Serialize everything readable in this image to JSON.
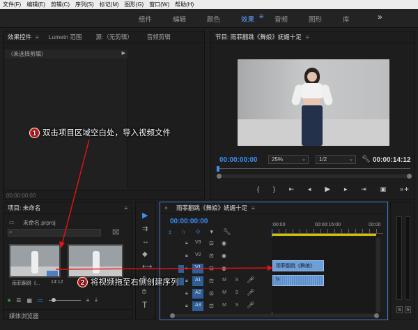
{
  "menu": [
    "文件(F)",
    "编辑(E)",
    "剪辑(C)",
    "序列(S)",
    "标记(M)",
    "图形(G)",
    "窗口(W)",
    "帮助(H)"
  ],
  "workspaces": {
    "items": [
      "组件",
      "编辑",
      "颜色",
      "效果",
      "音频",
      "图形",
      "库"
    ],
    "active": "效果",
    "more": "»"
  },
  "effect_panel": {
    "tabs": [
      "效果控件",
      "Lumetri 范围",
      "源:（无剪辑）",
      "音频剪辑"
    ],
    "no_clip": "（未选择剪辑）",
    "timecode": "00:00:00:00"
  },
  "program": {
    "title": "节目: 雨菲翻跳《舞娘》妩媚十足",
    "timecode": "00:00:00:00",
    "fit": "25%",
    "quality": "1/2",
    "duration": "00:00:14:12"
  },
  "project": {
    "title": "项目: 未命名",
    "file": "未命名.prproj",
    "clip_name": "雨菲翻跳《...",
    "clip_duration": "14:12",
    "media_browser": "媒体浏览器"
  },
  "timeline": {
    "title": "雨菲翻跳《舞娘》妩媚十足",
    "timecode": "00:00:00:00",
    "ruler": [
      ":00:00",
      "00:00:15:00",
      "00:00"
    ],
    "video_tracks": [
      "V3",
      "V2",
      "V1"
    ],
    "audio_tracks": [
      "A1",
      "A2",
      "A3"
    ],
    "clip_label": "雨菲翻跳《舞娘》",
    "track_btns": {
      "mute": "M",
      "solo": "S"
    }
  },
  "audio_meter": {
    "solo": [
      "S",
      "S"
    ]
  },
  "callouts": [
    {
      "n": "1",
      "text": "双击项目区域空白处，导入视频文件"
    },
    {
      "n": "2",
      "text": "将视频拖至右侧创建序列"
    }
  ],
  "colors": {
    "accent": "#3c8df5",
    "callout": "#d31a1a"
  }
}
